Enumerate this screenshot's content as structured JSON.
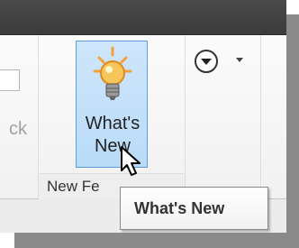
{
  "ribbon": {
    "partial_left_text": "ck",
    "whats_new_button": {
      "line1": "What's",
      "line2": "New",
      "icon": "lightbulb-icon"
    },
    "group_label": "New Fe",
    "dropdown": {
      "icon": "circle-chevron-down-icon"
    }
  },
  "tooltip": {
    "text": "What's New"
  },
  "cursor": {
    "icon": "mouse-pointer-icon"
  },
  "colors": {
    "titlebar": "#3f3f3f",
    "button_highlight": "#c5e2fa",
    "button_border": "#5a9fdc",
    "accent_orange": "#f3a23a"
  }
}
